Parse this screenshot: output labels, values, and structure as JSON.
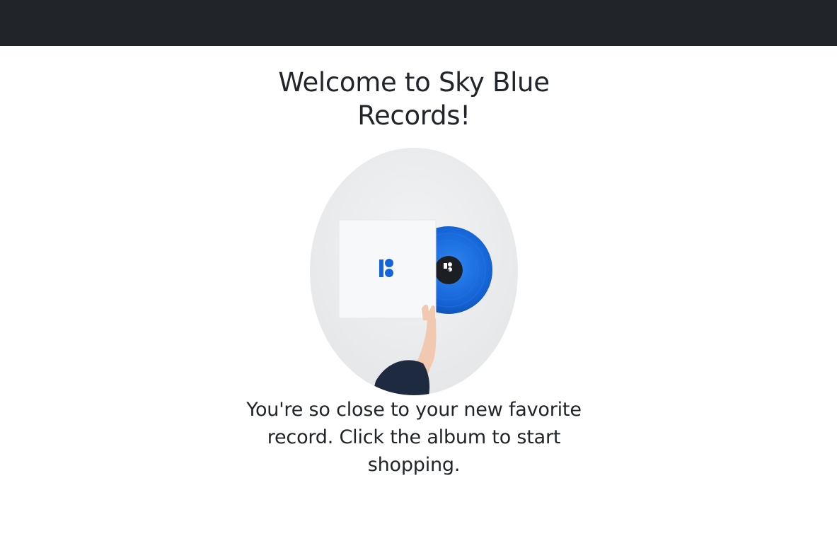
{
  "header": {
    "title": "Welcome to Sky Blue Records!"
  },
  "hero": {
    "image_description": "hand holding a white record sleeve with a blue vinyl record",
    "tagline": "You're so close to your new favorite record. Click the album to start shopping."
  },
  "colors": {
    "navbar": "#212529",
    "vinyl": "#1565d8",
    "text": "#212529"
  }
}
